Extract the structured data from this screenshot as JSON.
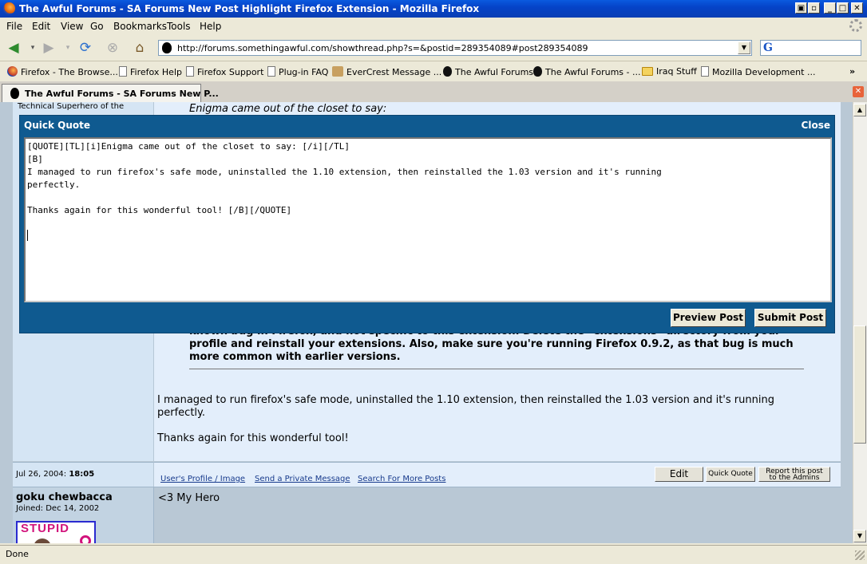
{
  "window": {
    "title": "The Awful Forums - SA Forums New Post Highlight Firefox Extension - Mozilla Firefox"
  },
  "menu": [
    "File",
    "Edit",
    "View",
    "Go",
    "Bookmarks",
    "Tools",
    "Help"
  ],
  "address": {
    "url": "http://forums.somethingawful.com/showthread.php?s=&postid=289354089#post289354089"
  },
  "bookmarks": [
    {
      "label": "Firefox - The Browse...",
      "icon": "firefox-icon"
    },
    {
      "label": "Firefox Help",
      "icon": "page-icon"
    },
    {
      "label": "Firefox Support",
      "icon": "page-icon"
    },
    {
      "label": "Plug-in FAQ",
      "icon": "page-icon"
    },
    {
      "label": "EverCrest Message ...",
      "icon": "evercrest-icon"
    },
    {
      "label": "The Awful Forums",
      "icon": "grenade-icon"
    },
    {
      "label": "The Awful Forums - ...",
      "icon": "grenade-icon"
    },
    {
      "label": "Iraq Stuff",
      "icon": "folder-icon"
    },
    {
      "label": "Mozilla Development ...",
      "icon": "page-icon"
    }
  ],
  "tab": {
    "label": "The Awful Forums - SA Forums New P..."
  },
  "page": {
    "user_title_fragment": "Technical Superhero of the",
    "quote_intro": "Enigma came out of the closet to say:",
    "bold_quote": {
      "line1": "known bug in Firefox, and not specific to this extension. Delete the \"extensions\" directory from your",
      "line2": "profile and reinstall your extensions. Also, make sure you're running Firefox 0.9.2, as that bug is much",
      "line3": "more common with earlier versions."
    },
    "reply_line1": "I managed to run firefox's safe mode, uninstalled the 1.10 extension, then reinstalled the 1.03 version and it's running",
    "reply_line2": "perfectly.",
    "reply_line3": "Thanks again for this wonderful tool!",
    "post_date": "Jul 26, 2004:",
    "post_time": "18:05",
    "links": {
      "profile": "User's Profile / Image",
      "pm": "Send a Private Message",
      "search": "Search For More Posts"
    },
    "buttons": {
      "edit": "Edit",
      "quick_quote": "Quick Quote",
      "report_line1": "Report this post",
      "report_line2": "to the Admins"
    },
    "next_post": {
      "username": "goku chewbacca",
      "joined": "Joined: Dec 14, 2002",
      "avatar_text": "STUPID",
      "body": "<3 My Hero"
    }
  },
  "quick_quote": {
    "title": "Quick Quote",
    "close": "Close",
    "lines": [
      "[QUOTE][TL][i]Enigma came out of the closet to say: [/i][/TL]",
      "[B]",
      "I managed to run firefox's safe mode, uninstalled the 1.10 extension, then reinstalled the 1.03 version and it's running",
      "perfectly.",
      "",
      "Thanks again for this wonderful tool! [/B][/QUOTE]"
    ],
    "preview_label": "Preview Post",
    "submit_label": "Submit Post"
  },
  "status": {
    "text": "Done"
  }
}
